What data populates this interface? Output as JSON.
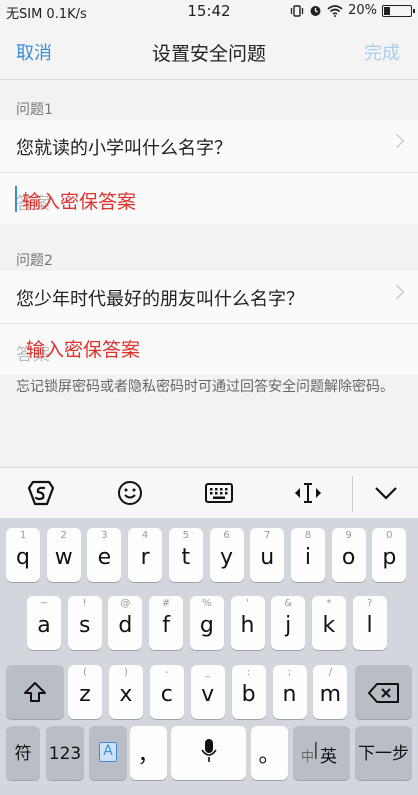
{
  "status_bar": {
    "carrier": "无SIM 0.1K/s",
    "time": "15:42",
    "battery": "20%",
    "battery_level": 0.2
  },
  "nav": {
    "cancel": "取消",
    "title": "设置安全问题",
    "done": "完成"
  },
  "q1": {
    "label": "问题1",
    "question": "您就读的小学叫什么名字？",
    "answer_placeholder": "答案",
    "answer_overlay": "输入密保答案"
  },
  "q2": {
    "label": "问题2",
    "question": "您少年时代最好的朋友叫什么名字？",
    "answer_placeholder": "答案",
    "answer_overlay": "输入密保答案"
  },
  "hint": "忘记锁屏密码或者隐私密码时可通过回答安全问题解除密码。",
  "toolbar": {
    "icons": [
      "sogou-logo-icon",
      "emoji-icon",
      "keyboard-icon",
      "cursor-move-icon",
      "collapse-icon"
    ]
  },
  "keyboard": {
    "row1": [
      [
        "q",
        "1"
      ],
      [
        "w",
        "2"
      ],
      [
        "e",
        "3"
      ],
      [
        "r",
        "4"
      ],
      [
        "t",
        "5"
      ],
      [
        "y",
        "6"
      ],
      [
        "u",
        "7"
      ],
      [
        "i",
        "8"
      ],
      [
        "o",
        "9"
      ],
      [
        "p",
        "0"
      ]
    ],
    "row2": [
      [
        "a",
        "~"
      ],
      [
        "s",
        "!"
      ],
      [
        "d",
        "@"
      ],
      [
        "f",
        "#"
      ],
      [
        "g",
        "%"
      ],
      [
        "h",
        "'"
      ],
      [
        "j",
        "&"
      ],
      [
        "k",
        "*"
      ],
      [
        "l",
        "?"
      ]
    ],
    "row3": [
      [
        "z",
        "("
      ],
      [
        "x",
        ")"
      ],
      [
        "c",
        "-"
      ],
      [
        "v",
        "_"
      ],
      [
        "b",
        ":"
      ],
      [
        "n",
        ";"
      ],
      [
        "m",
        "/"
      ]
    ],
    "sym": "符",
    "num": "123",
    "a_label": "A",
    "comma": "，",
    "period": "。",
    "lang_a": "中",
    "lang_b": "英",
    "next": "下一步"
  }
}
